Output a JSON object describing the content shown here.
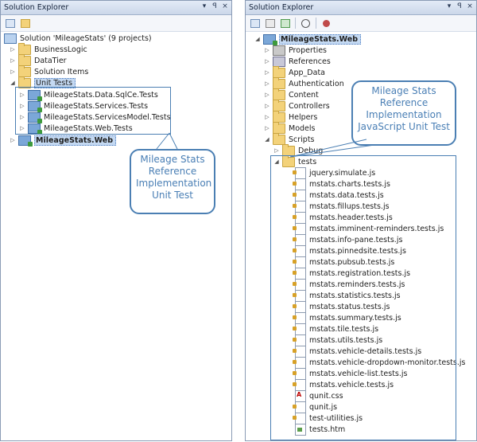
{
  "left": {
    "title": "Solution Explorer",
    "title_buttons": [
      "▾",
      "ꟼ",
      "×"
    ],
    "solution": "Solution 'MileageStats' (9 projects)",
    "items": [
      {
        "label": "BusinessLogic"
      },
      {
        "label": "DataTier"
      },
      {
        "label": "Solution Items"
      },
      {
        "label": "Unit Tests"
      }
    ],
    "tests": [
      {
        "label": "MileageStats.Data.SqlCe.Tests"
      },
      {
        "label": "MileageStats.Services.Tests"
      },
      {
        "label": "MileageStats.ServicesModel.Tests"
      },
      {
        "label": "MileageStats.Web.Tests"
      }
    ],
    "web_project": "MileageStats.Web",
    "callout": [
      "Mileage Stats",
      "Reference",
      "Implementation",
      "Unit Test"
    ]
  },
  "right": {
    "title": "Solution Explorer",
    "title_buttons": [
      "▾",
      "ꟼ",
      "×"
    ],
    "project": "MileageStats.Web",
    "items": [
      {
        "label": "Properties"
      },
      {
        "label": "References"
      },
      {
        "label": "App_Data"
      },
      {
        "label": "Authentication"
      },
      {
        "label": "Content"
      },
      {
        "label": "Controllers"
      },
      {
        "label": "Helpers"
      },
      {
        "label": "Models"
      },
      {
        "label": "Scripts"
      },
      {
        "label": "Debug"
      },
      {
        "label": "tests"
      }
    ],
    "test_files": [
      {
        "label": "jquery.simulate.js"
      },
      {
        "label": "mstats.charts.tests.js"
      },
      {
        "label": "mstats.data.tests.js"
      },
      {
        "label": "mstats.fillups.tests.js"
      },
      {
        "label": "mstats.header.tests.js"
      },
      {
        "label": "mstats.imminent-reminders.tests.js"
      },
      {
        "label": "mstats.info-pane.tests.js"
      },
      {
        "label": "mstats.pinnedsite.tests.js"
      },
      {
        "label": "mstats.pubsub.tests.js"
      },
      {
        "label": "mstats.registration.tests.js"
      },
      {
        "label": "mstats.reminders.tests.js"
      },
      {
        "label": "mstats.statistics.tests.js"
      },
      {
        "label": "mstats.status.tests.js"
      },
      {
        "label": "mstats.summary.tests.js"
      },
      {
        "label": "mstats.tile.tests.js"
      },
      {
        "label": "mstats.utils.tests.js"
      },
      {
        "label": "mstats.vehicle-details.tests.js"
      },
      {
        "label": "mstats.vehicle-dropdown-monitor.tests.js"
      },
      {
        "label": "mstats.vehicle-list.tests.js"
      },
      {
        "label": "mstats.vehicle.tests.js"
      },
      {
        "label": "qunit.css"
      },
      {
        "label": "qunit.js"
      },
      {
        "label": "test-utilities.js"
      },
      {
        "label": "tests.htm"
      }
    ],
    "callout": [
      "Mileage Stats",
      "Reference",
      "Implementation",
      "JavaScript Unit Test"
    ]
  }
}
